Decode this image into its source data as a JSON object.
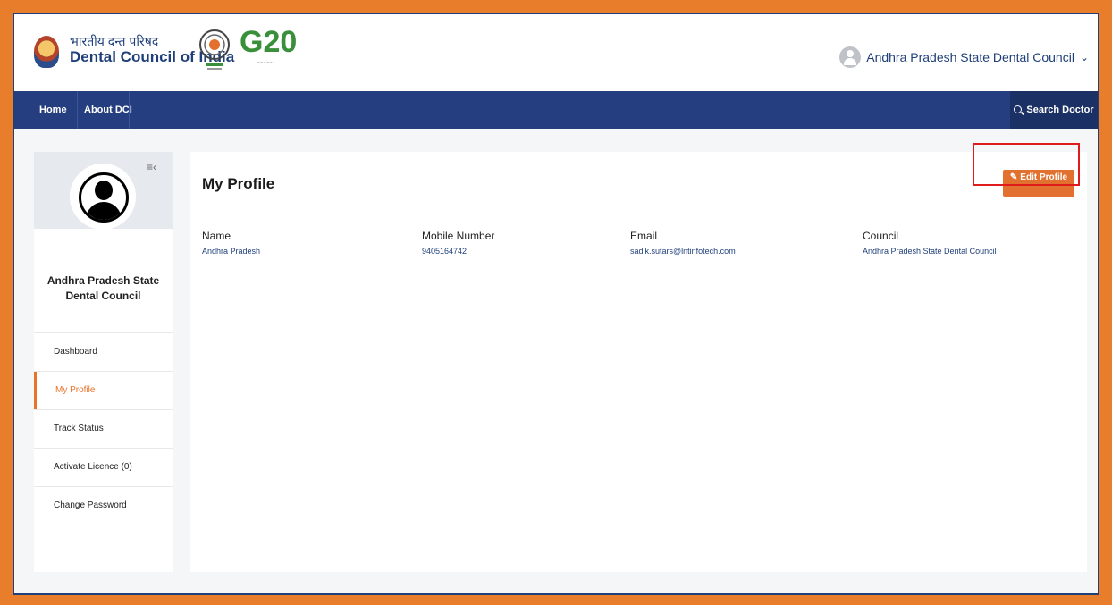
{
  "header": {
    "brand_hindi": "भारतीय दन्त परिषद",
    "brand_english": "Dental Council of India",
    "user_name": "Andhra Pradesh State Dental Council",
    "g20_text": "G20"
  },
  "nav": {
    "home": "Home",
    "about": "About DCI",
    "search_doctor": "Search Doctor"
  },
  "sidebar": {
    "council_name": "Andhra Pradesh State Dental Council",
    "items": [
      {
        "label": "Dashboard",
        "active": false
      },
      {
        "label": "My Profile",
        "active": true
      },
      {
        "label": "Track Status",
        "active": false
      },
      {
        "label": "Activate Licence (0)",
        "active": false
      },
      {
        "label": "Change Password",
        "active": false
      }
    ]
  },
  "main": {
    "title": "My Profile",
    "edit_button": "Edit Profile",
    "fields": {
      "name_label": "Name",
      "name_value": "Andhra Pradesh",
      "mobile_label": "Mobile Number",
      "mobile_value": "9405164742",
      "email_label": "Email",
      "email_value": "sadik.sutars@lntinfotech.com",
      "council_label": "Council",
      "council_value": "Andhra Pradesh State Dental Council"
    }
  },
  "colors": {
    "frame_border": "#e87d2b",
    "navbar": "#243e7f",
    "accent": "#e8742a",
    "highlight": "#e01b1b"
  }
}
